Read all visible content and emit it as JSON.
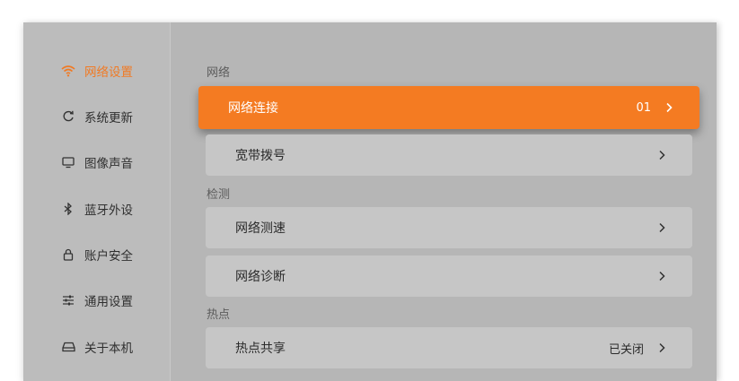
{
  "sidebar": {
    "items": [
      {
        "label": "网络设置",
        "icon": "wifi-icon",
        "active": true
      },
      {
        "label": "系统更新",
        "icon": "refresh-icon"
      },
      {
        "label": "图像声音",
        "icon": "monitor-icon"
      },
      {
        "label": "蓝牙外设",
        "icon": "bluetooth-icon"
      },
      {
        "label": "账户安全",
        "icon": "lock-icon"
      },
      {
        "label": "通用设置",
        "icon": "sliders-icon"
      },
      {
        "label": "关于本机",
        "icon": "device-icon"
      }
    ]
  },
  "main": {
    "sections": [
      {
        "title": "网络"
      },
      {
        "title": "检测"
      },
      {
        "title": "热点"
      }
    ],
    "rows": [
      {
        "label": "网络连接",
        "value": "01",
        "focused": true
      },
      {
        "label": "宽带拨号",
        "value": ""
      },
      {
        "label": "网络测速",
        "value": ""
      },
      {
        "label": "网络诊断",
        "value": ""
      },
      {
        "label": "热点共享",
        "value": "已关闭"
      }
    ]
  },
  "colors": {
    "accent": "#f47b22",
    "panel": "#b6b6b6",
    "row": "#c6c6c6"
  }
}
